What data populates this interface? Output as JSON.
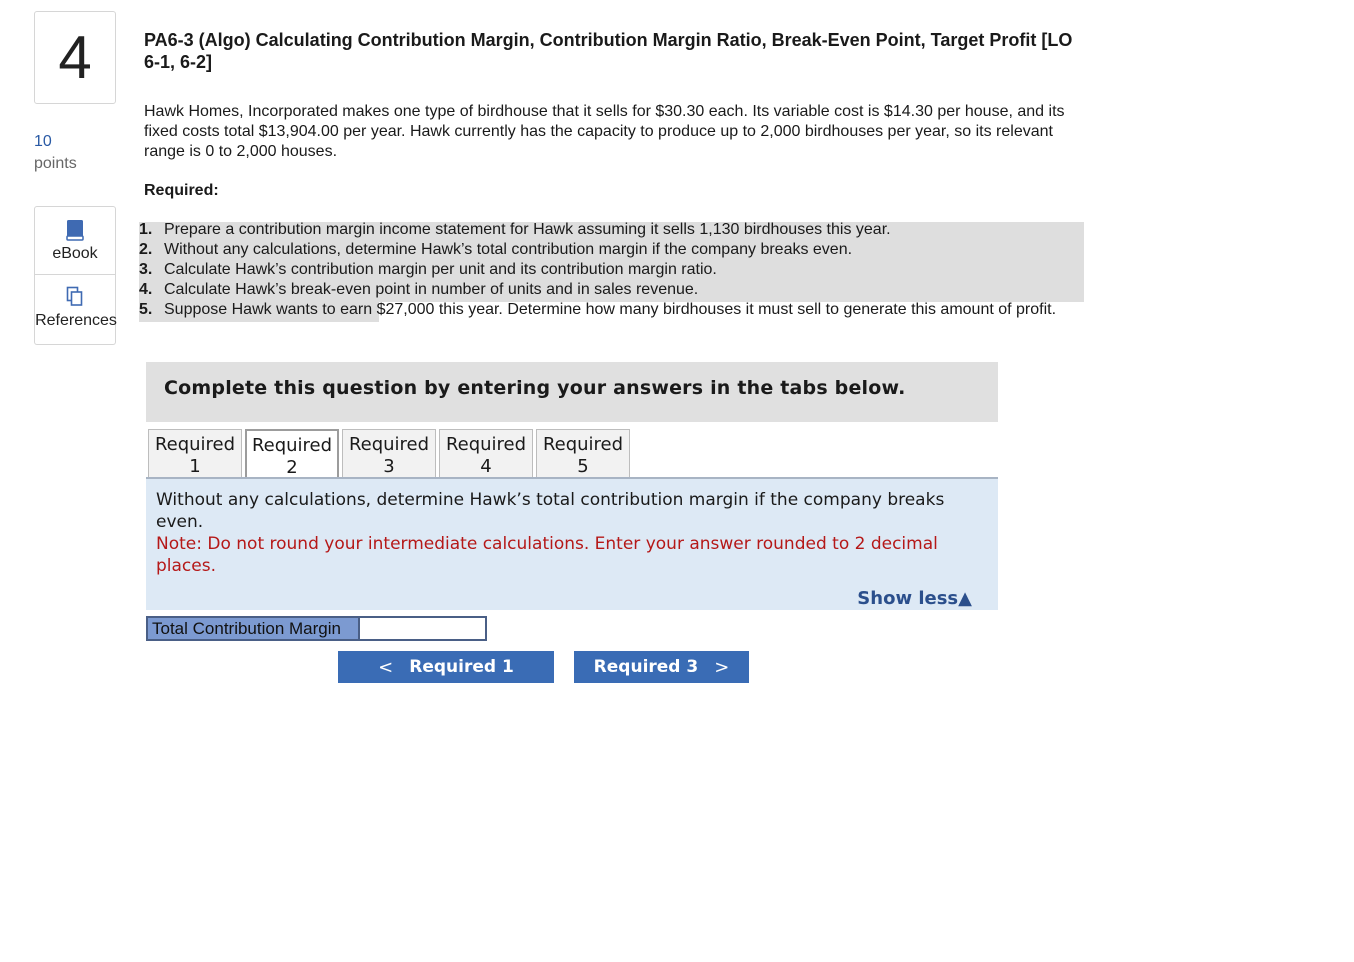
{
  "question": {
    "number": "4",
    "points_value": "10",
    "points_label": "points",
    "title": "PA6-3 (Algo) Calculating Contribution Margin, Contribution Margin Ratio, Break-Even Point, Target Profit [LO 6-1, 6-2]",
    "intro": "Hawk Homes, Incorporated makes one type of birdhouse that it sells for $30.30 each. Its variable cost is $14.30 per house, and its fixed costs total $13,904.00 per year. Hawk currently has the capacity to produce up to 2,000 birdhouses per year, so its relevant range is 0 to 2,000 houses.",
    "required_heading": "Required:",
    "requirements": [
      {
        "num": "1.",
        "text": "Prepare a contribution margin income statement for Hawk assuming it sells 1,130 birdhouses this year."
      },
      {
        "num": "2.",
        "text": "Without any calculations, determine Hawk’s total contribution margin if the company breaks even."
      },
      {
        "num": "3.",
        "text": "Calculate Hawk’s contribution margin per unit and its contribution margin ratio."
      },
      {
        "num": "4.",
        "text": "Calculate Hawk’s break-even point in number of units and in sales revenue."
      },
      {
        "num": "5.",
        "text": "Suppose Hawk wants to earn $27,000 this year. Determine how many birdhouses it must sell to generate this amount of profit."
      }
    ]
  },
  "sidebar": {
    "ebook_label": "eBook",
    "references_label": "References",
    "ebook_icon": "book-icon",
    "references_icon": "copy-icon"
  },
  "complete_banner": "Complete this question by entering your answers in the tabs below.",
  "tabs": [
    {
      "line1": "Required",
      "line2": "1",
      "active": false
    },
    {
      "line1": "Required",
      "line2": "2",
      "active": true
    },
    {
      "line1": "Required",
      "line2": "3",
      "active": false
    },
    {
      "line1": "Required",
      "line2": "4",
      "active": false
    },
    {
      "line1": "Required",
      "line2": "5",
      "active": false
    }
  ],
  "panel": {
    "instruction": "Without any calculations, determine Hawk’s total contribution margin if the company breaks even.",
    "note": "Note: Do not round your intermediate calculations. Enter your answer rounded to 2 decimal places.",
    "show_less": "Show less"
  },
  "answer": {
    "label": "Total Contribution Margin",
    "value": ""
  },
  "nav": {
    "prev_label": "Required 1",
    "next_label": "Required 3"
  },
  "colors": {
    "accent": "#3a6cb5",
    "note_red": "#b51818",
    "panel_bg": "#dde9f5"
  }
}
